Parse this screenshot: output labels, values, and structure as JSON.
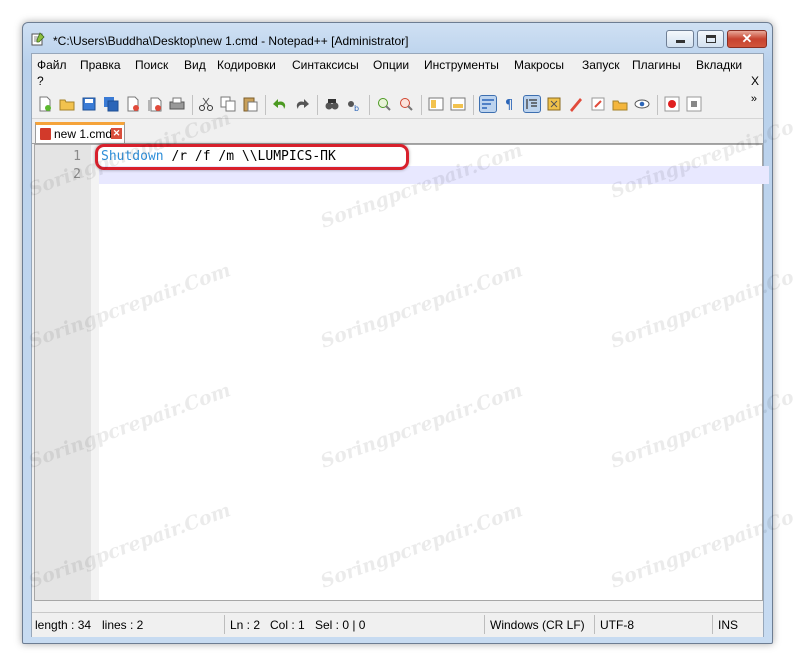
{
  "window": {
    "title": "*C:\\Users\\Buddha\\Desktop\\new 1.cmd - Notepad++ [Administrator]",
    "close_glyph": "✕"
  },
  "menu": {
    "items": [
      "Файл",
      "Правка",
      "Поиск",
      "Вид",
      "Кодировки",
      "Синтаксисы",
      "Опции",
      "Инструменты",
      "Макросы",
      "Запуск",
      "Плагины",
      "Вкладки"
    ],
    "help": "?",
    "close": "X"
  },
  "toolbar": {
    "icons": [
      "new-file",
      "open-file",
      "save",
      "save-all",
      "close",
      "close-all",
      "print",
      "cut",
      "copy",
      "paste",
      "undo",
      "redo",
      "find",
      "replace",
      "zoom-in",
      "zoom-out",
      "sync-vertical",
      "sync-horizontal",
      "word-wrap",
      "show-all-chars",
      "indent-guide",
      "user-defined-language",
      "document-map",
      "function-list",
      "folder-as-workspace",
      "monitoring",
      "record-macro",
      "stop-macro"
    ],
    "more": "»"
  },
  "tabs": [
    {
      "label": "new 1.cmd",
      "close": "✕"
    }
  ],
  "editor": {
    "line_numbers": [
      "1",
      "2"
    ],
    "line1_keyword": "Shutdown",
    "line1_rest": " /r /f /m \\\\LUMPICS-ПК",
    "line2": "",
    "watermark": "Soringpcrepair.Com"
  },
  "status": {
    "length": "length : 34",
    "lines": "lines : 2",
    "ln": "Ln : 2",
    "col": "Col : 1",
    "sel": "Sel : 0 | 0",
    "eol": "Windows (CR LF)",
    "encoding": "UTF-8",
    "mode": "INS"
  },
  "colors": {
    "keyword": "#2f8fd9",
    "current_line": "#e8e8ff",
    "highlight_box": "#d8202c",
    "tab_accent": "#f5a33a"
  }
}
